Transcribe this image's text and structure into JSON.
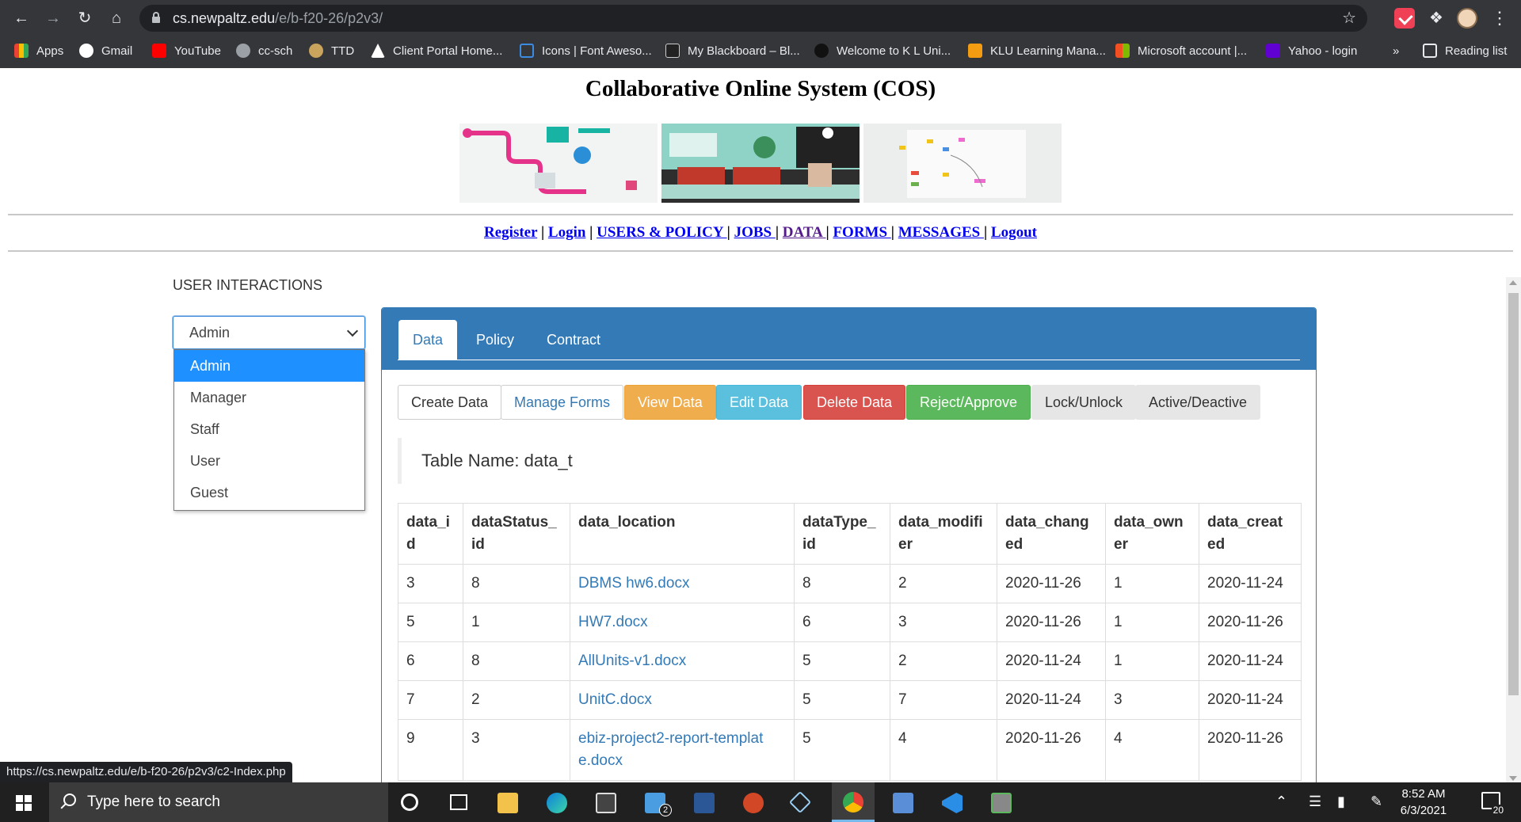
{
  "browser": {
    "url_host": "cs.newpaltz.edu",
    "url_path": "/e/b-f20-26/p2v3/",
    "bookmarks": [
      {
        "label": "Apps",
        "color": "#e94235"
      },
      {
        "label": "Gmail",
        "color": "#ffffff"
      },
      {
        "label": "YouTube",
        "color": "#ff0000"
      },
      {
        "label": "cc-sch",
        "color": "#9aa0a6"
      },
      {
        "label": "TTD",
        "color": "#c9a45c"
      },
      {
        "label": "Client Portal Home...",
        "color": "#ffffff"
      },
      {
        "label": "Icons | Font Aweso...",
        "color": "#3b8be0"
      },
      {
        "label": "My Blackboard – Bl...",
        "color": "#cccccc"
      },
      {
        "label": "Welcome to K L Uni...",
        "color": "#111111"
      },
      {
        "label": "KLU Learning Mana...",
        "color": "#f39c12"
      },
      {
        "label": "Microsoft account |...",
        "color": "#f25022"
      },
      {
        "label": "Yahoo - login",
        "color": "#6001d2"
      }
    ],
    "more_label": "»",
    "reading_list": "Reading list",
    "status_url": "https://cs.newpaltz.edu/e/b-f20-26/p2v3/c2-Index.php"
  },
  "page": {
    "title": "Collaborative Online System (COS)",
    "nav": [
      {
        "label": "Register",
        "sep": " | "
      },
      {
        "label": "Login",
        "sep": " | "
      },
      {
        "label": "USERS & POLICY ",
        "sep": "| "
      },
      {
        "label": "JOBS ",
        "sep": "| "
      },
      {
        "label": "DATA ",
        "sep": "| "
      },
      {
        "label": "FORMS ",
        "sep": "| "
      },
      {
        "label": "MESSAGES ",
        "sep": "| "
      },
      {
        "label": "Logout",
        "sep": ""
      }
    ],
    "section_label": "USER INTERACTIONS"
  },
  "role_select": {
    "value": "Admin",
    "options": [
      "Admin",
      "Manager",
      "Staff",
      "User",
      "Guest"
    ]
  },
  "panel": {
    "tabs": [
      "Data",
      "Policy",
      "Contract"
    ],
    "buttons": [
      "Create Data",
      "Manage Forms",
      "View Data",
      "Edit Data",
      "Delete Data",
      "Reject/Approve",
      "Lock/Unlock",
      "Active/Deactive"
    ],
    "table_name": "Table Name: data_t",
    "columns": [
      [
        "data_i",
        "d"
      ],
      [
        "dataStatus_",
        "id"
      ],
      [
        "data_location",
        ""
      ],
      [
        "dataType_",
        "id"
      ],
      [
        "data_modifi",
        "er"
      ],
      [
        "data_chang",
        "ed"
      ],
      [
        "data_own",
        "er"
      ],
      [
        "data_creat",
        "ed"
      ]
    ],
    "rows": [
      [
        "3",
        "8",
        "DBMS hw6.docx",
        "8",
        "2",
        "2020-11-26",
        "1",
        "2020-11-24"
      ],
      [
        "5",
        "1",
        "HW7.docx",
        "6",
        "3",
        "2020-11-26",
        "1",
        "2020-11-26"
      ],
      [
        "6",
        "8",
        "AllUnits-v1.docx",
        "5",
        "2",
        "2020-11-24",
        "1",
        "2020-11-24"
      ],
      [
        "7",
        "2",
        "UnitC.docx",
        "5",
        "7",
        "2020-11-24",
        "3",
        "2020-11-24"
      ],
      [
        "9",
        "3",
        "ebiz-project2-report-templat e.docx",
        "5",
        "4",
        "2020-11-26",
        "4",
        "2020-11-26"
      ]
    ]
  },
  "taskbar": {
    "search_placeholder": "Type here to search",
    "time": "8:52 AM",
    "date": "6/3/2021",
    "mail_badge": "2",
    "notifications": "20"
  }
}
